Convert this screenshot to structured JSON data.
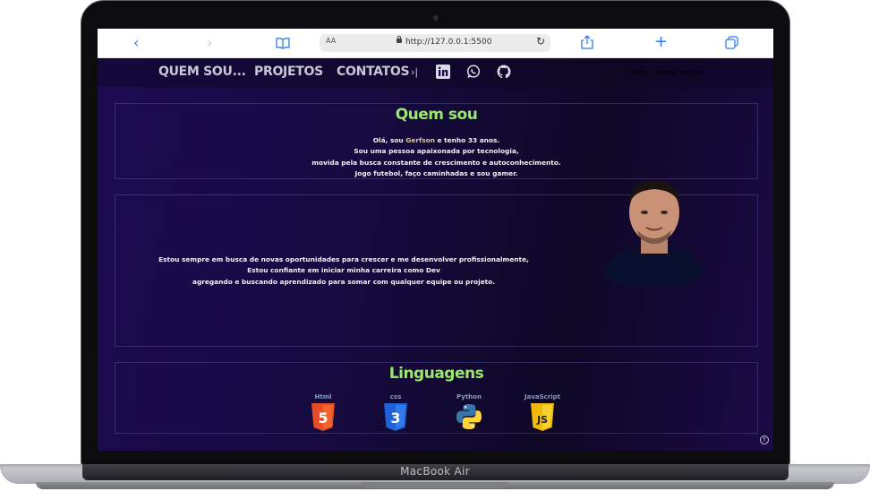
{
  "device": {
    "label": "MacBook Air"
  },
  "browser": {
    "url": "http://127.0.0.1:5500",
    "text_size_label": "AA",
    "icons": [
      "back-icon",
      "forward-icon",
      "book-icon",
      "lock-icon",
      "reload-icon",
      "share-icon",
      "plus-icon",
      "tabs-icon"
    ]
  },
  "nav": {
    "links": [
      "QUEM SOU...",
      "PROJETOS",
      "CONTATOS"
    ],
    "arrow": "›|",
    "social_icons": [
      "linkedin-icon",
      "whatsapp-icon",
      "github-icon"
    ],
    "menu_text": "Menu – Redes sociais"
  },
  "about": {
    "title": "Quem sou",
    "line1_pre": "Olá, sou ",
    "line1_name": "Gerfson",
    "line1_post": " e tenho 33 anos.",
    "line2": "Sou uma pessoa apaixonada por tecnologia,",
    "line3": "movida pela busca constante de crescimento e autoconhecimento.",
    "line4": "Jogo futebol, faço caminhadas e sou gamer."
  },
  "career": {
    "line1": "Estou sempre em busca de novas oportunidades para crescer e me desenvolver profissionalmente,",
    "line2": "Estou confiante em iniciar minha carreira como Dev",
    "line3": "agregando e buscando aprendizado para somar com qualquer equipe ou projeto."
  },
  "languages": {
    "title": "Linguagens",
    "items": [
      {
        "label": "Html",
        "icon": "html5-icon",
        "badge": "5",
        "color": "#e44d26"
      },
      {
        "label": "css",
        "icon": "css3-icon",
        "badge": "3",
        "color": "#1f62d8"
      },
      {
        "label": "Python",
        "icon": "python-icon",
        "badge": "",
        "color": "#3776ab"
      },
      {
        "label": "JavaScript",
        "icon": "js-icon",
        "badge": "JS",
        "color": "#f0c419"
      }
    ]
  },
  "colors": {
    "accent": "#9be86a",
    "background": "#1a0c4a"
  }
}
